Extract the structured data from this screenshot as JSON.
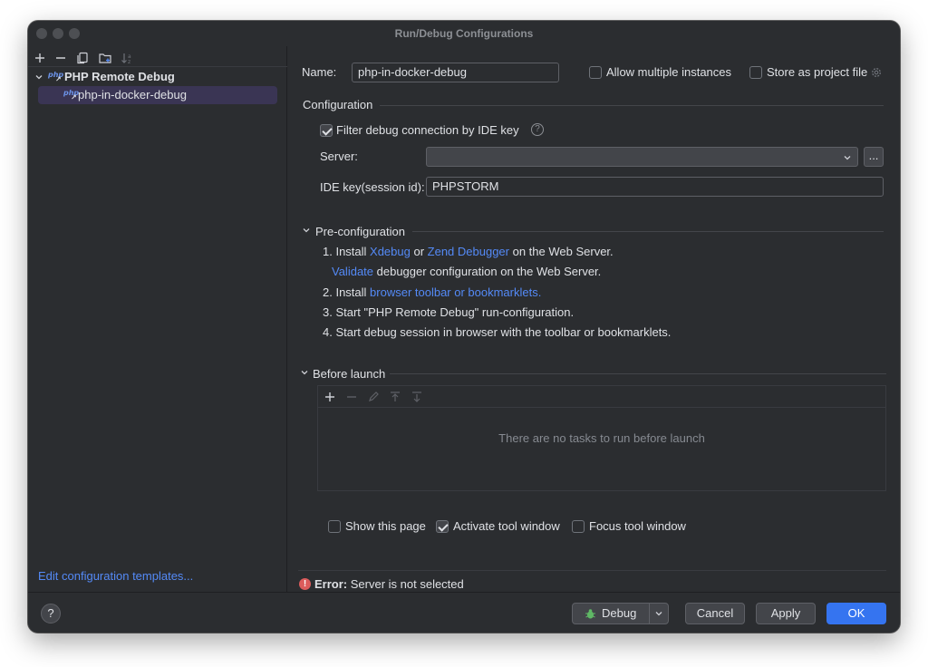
{
  "window": {
    "title": "Run/Debug Configurations"
  },
  "sidebar": {
    "toolbar_icons": [
      "add-icon",
      "remove-icon",
      "copy-icon",
      "new-folder-icon",
      "sort-icon"
    ],
    "tree": {
      "group_label": "PHP Remote Debug",
      "group_badge": "php",
      "item_label": "php-in-docker-debug",
      "item_badge": "php"
    },
    "edit_templates_link": "Edit configuration templates..."
  },
  "form": {
    "name_label": "Name:",
    "name_value": "php-in-docker-debug",
    "allow_multiple_label": "Allow multiple instances",
    "store_project_label": "Store as project file",
    "configuration_heading": "Configuration",
    "filter_debug_label": "Filter debug connection by IDE key",
    "server_label": "Server:",
    "server_value": "",
    "browse_label": "...",
    "ide_key_label": "IDE key(session id):",
    "ide_key_value": "PHPSTORM"
  },
  "preconfig": {
    "heading": "Pre-configuration",
    "step1_prefix": "1. Install ",
    "step1_link1": "Xdebug",
    "step1_mid": " or ",
    "step1_link2": "Zend Debugger",
    "step1_suffix": " on the Web Server.",
    "validate_link": "Validate",
    "validate_suffix": " debugger configuration on the Web Server.",
    "step2_prefix": "2. Install ",
    "step2_link": "browser toolbar or bookmarklets.",
    "step3": "3. Start \"PHP Remote Debug\" run-configuration.",
    "step4": "4. Start debug session in browser with the toolbar or bookmarklets."
  },
  "before_launch": {
    "heading": "Before launch",
    "empty_text": "There are no tasks to run before launch",
    "show_page_label": "Show this page",
    "activate_tool_label": "Activate tool window",
    "focus_tool_label": "Focus tool window"
  },
  "error": {
    "prefix": "Error:",
    "message": "Server is not selected"
  },
  "footer": {
    "help_label": "?",
    "debug_label": "Debug",
    "cancel_label": "Cancel",
    "apply_label": "Apply",
    "ok_label": "OK"
  },
  "colors": {
    "background": "#2b2d30",
    "link": "#548af7",
    "primary_button": "#3574f0",
    "error": "#db5c5c",
    "selection": "#3a3554"
  }
}
